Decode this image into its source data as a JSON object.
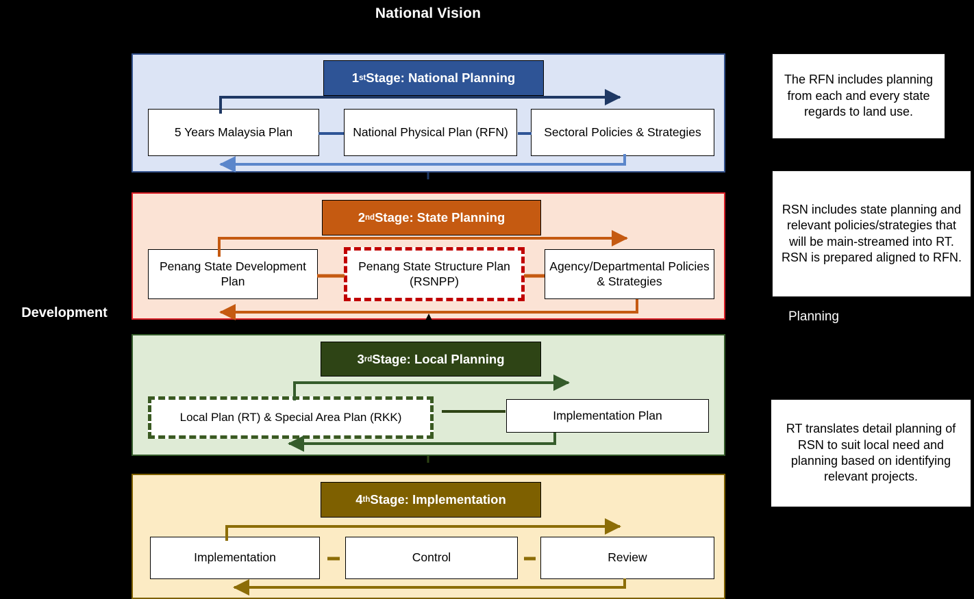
{
  "header": {
    "title": "National Vision"
  },
  "left_label": {
    "text": "Development"
  },
  "right_label": {
    "text": "Planning"
  },
  "colors": {
    "stage1_accent": "#2E5496",
    "stage1_fill": "#DCE4F5",
    "stage2_accent": "#C55A11",
    "stage2_fill": "#FBE3D5",
    "stage2_border": "#D91F26",
    "stage3_accent": "#2E4415",
    "stage3_fill": "#DFEBD6",
    "stage4_accent": "#7E6000",
    "stage4_fill": "#FCEBC4",
    "highlight_dashed_red": "#C00000",
    "highlight_dashed_green": "#3A5A22"
  },
  "stages": [
    {
      "ordinal": "1",
      "ordinal_suffix": "st",
      "title_rest": " Stage: National Planning",
      "nodes": [
        {
          "label": "5 Years Malaysia Plan"
        },
        {
          "label": "National Physical Plan (RFN)"
        },
        {
          "label": "Sectoral Policies & Strategies"
        }
      ]
    },
    {
      "ordinal": "2",
      "ordinal_suffix": "nd",
      "title_rest": " Stage: State Planning",
      "nodes": [
        {
          "label": "Penang State Development Plan"
        },
        {
          "label": "Penang State Structure Plan (RSNPP)"
        },
        {
          "label": "Agency/Departmental Policies & Strategies"
        }
      ]
    },
    {
      "ordinal": "3",
      "ordinal_suffix": "rd",
      "title_rest": " Stage: Local Planning",
      "nodes": [
        {
          "label": "Local Plan (RT) & Special Area  Plan (RKK)"
        },
        {
          "label": "Implementation Plan"
        }
      ]
    },
    {
      "ordinal": "4",
      "ordinal_suffix": "th",
      "title_rest": " Stage: Implementation",
      "nodes": [
        {
          "label": "Implementation"
        },
        {
          "label": "Control"
        },
        {
          "label": "Review"
        }
      ]
    }
  ],
  "notes": [
    {
      "text": "The RFN includes planning  from each and every state regards to land use."
    },
    {
      "text": "RSN includes state planning  and relevant policies/strategies that will  be main-streamed into RT. RSN is prepared aligned  to RFN."
    },
    {
      "text": "RT translates detail planning  of RSN to suit local need and planning based on identifying relevant projects."
    }
  ]
}
